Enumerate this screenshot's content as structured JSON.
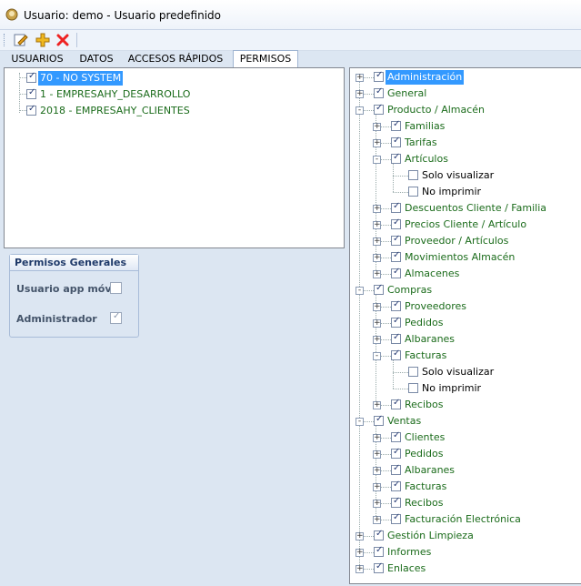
{
  "window": {
    "title": "Usuario: demo - Usuario predefinido"
  },
  "toolbar": {
    "edit_icon": "edit-icon",
    "add_icon": "add-icon",
    "delete_icon": "delete-icon"
  },
  "tabs": [
    "USUARIOS",
    "DATOS",
    "ACCESOS RÁPIDOS",
    "PERMISOS"
  ],
  "companies": [
    {
      "label": "70 - NO SYSTEM",
      "checked": true,
      "selected": true
    },
    {
      "label": "1 - EMPRESAHY_DESARROLLO",
      "checked": true
    },
    {
      "label": "2018 - EMPRESAHY_CLIENTES",
      "checked": true
    }
  ],
  "permisos_generales": {
    "title": "Permisos Generales",
    "usuario_app_movil": {
      "label": "Usuario app móvil",
      "checked": false
    },
    "administrador": {
      "label": "Administrador",
      "checked": true
    }
  },
  "tree": [
    {
      "label": "Administración",
      "level": 0,
      "expander": "+",
      "checked": true,
      "selected": true
    },
    {
      "label": "General",
      "level": 0,
      "expander": "+",
      "checked": true
    },
    {
      "label": "Producto / Almacén",
      "level": 0,
      "expander": "-",
      "checked": true
    },
    {
      "label": "Familias",
      "level": 1,
      "expander": "+",
      "checked": true
    },
    {
      "label": "Tarifas",
      "level": 1,
      "expander": "+",
      "checked": true
    },
    {
      "label": "Artículos",
      "level": 1,
      "expander": "-",
      "checked": true
    },
    {
      "label": "Solo visualizar",
      "level": 2,
      "expander": "",
      "checked": false
    },
    {
      "label": "No imprimir",
      "level": 2,
      "expander": "",
      "checked": false
    },
    {
      "label": "Descuentos Cliente / Familia",
      "level": 1,
      "expander": "+",
      "checked": true
    },
    {
      "label": "Precios Cliente / Artículo",
      "level": 1,
      "expander": "+",
      "checked": true
    },
    {
      "label": "Proveedor / Artículos",
      "level": 1,
      "expander": "+",
      "checked": true
    },
    {
      "label": "Movimientos Almacén",
      "level": 1,
      "expander": "+",
      "checked": true
    },
    {
      "label": "Almacenes",
      "level": 1,
      "expander": "+",
      "checked": true
    },
    {
      "label": "Compras",
      "level": 0,
      "expander": "-",
      "checked": true
    },
    {
      "label": "Proveedores",
      "level": 1,
      "expander": "+",
      "checked": true
    },
    {
      "label": "Pedidos",
      "level": 1,
      "expander": "+",
      "checked": true
    },
    {
      "label": "Albaranes",
      "level": 1,
      "expander": "+",
      "checked": true
    },
    {
      "label": "Facturas",
      "level": 1,
      "expander": "-",
      "checked": true
    },
    {
      "label": "Solo visualizar",
      "level": 2,
      "expander": "",
      "checked": false
    },
    {
      "label": "No imprimir",
      "level": 2,
      "expander": "",
      "checked": false
    },
    {
      "label": "Recibos",
      "level": 1,
      "expander": "+",
      "checked": true
    },
    {
      "label": "Ventas",
      "level": 0,
      "expander": "-",
      "checked": true
    },
    {
      "label": "Clientes",
      "level": 1,
      "expander": "+",
      "checked": true
    },
    {
      "label": "Pedidos",
      "level": 1,
      "expander": "+",
      "checked": true
    },
    {
      "label": "Albaranes",
      "level": 1,
      "expander": "+",
      "checked": true
    },
    {
      "label": "Facturas",
      "level": 1,
      "expander": "+",
      "checked": true
    },
    {
      "label": "Recibos",
      "level": 1,
      "expander": "+",
      "checked": true
    },
    {
      "label": "Facturación Electrónica",
      "level": 1,
      "expander": "+",
      "checked": true
    },
    {
      "label": "Gestión Limpieza",
      "level": 0,
      "expander": "+",
      "checked": true
    },
    {
      "label": "Informes",
      "level": 0,
      "expander": "+",
      "checked": true
    },
    {
      "label": "Enlaces",
      "level": 0,
      "expander": "+",
      "checked": true
    }
  ]
}
